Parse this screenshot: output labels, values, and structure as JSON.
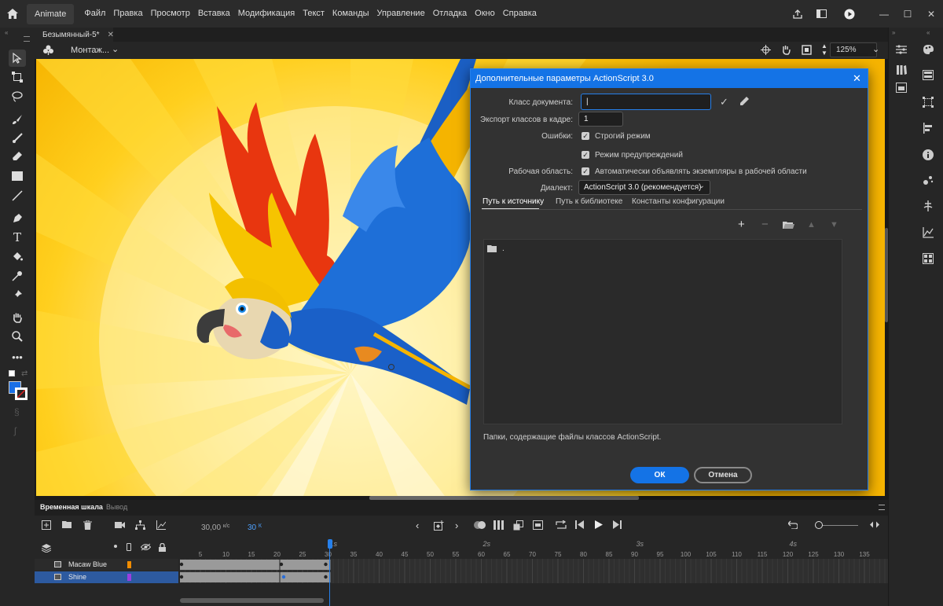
{
  "app": {
    "name": "Animate"
  },
  "menu": [
    "Файл",
    "Правка",
    "Просмотр",
    "Вставка",
    "Модификация",
    "Текст",
    "Команды",
    "Управление",
    "Отладка",
    "Окно",
    "Справка"
  ],
  "document": {
    "tab": "Безымянный-5*",
    "scene": "Монтаж..."
  },
  "editbar": {
    "zoom": "125%"
  },
  "dialog": {
    "title": "Дополнительные параметры ActionScript 3.0",
    "doc_class_label": "Класс документа:",
    "doc_class_value": "",
    "export_label": "Экспорт классов в кадре:",
    "export_value": "1",
    "errors_label": "Ошибки:",
    "strict_mode": "Строгий режим",
    "warnings_mode": "Режим предупреждений",
    "stage_label": "Рабочая область:",
    "auto_declare": "Автоматически объявлять экземпляры в рабочей области",
    "dialect_label": "Диалект:",
    "dialect_value": "ActionScript 3.0 (рекомендуется)",
    "tabs": [
      "Путь к источнику",
      "Путь к библиотеке",
      "Константы конфигурации"
    ],
    "path_entry": ".",
    "footnote": "Папки, содержащие файлы классов ActionScript.",
    "ok": "ОК",
    "cancel": "Отмена"
  },
  "timeline": {
    "tabs": [
      "Временная шкала",
      "Вывод"
    ],
    "fps": "30,00",
    "fps_unit": "к/с",
    "frame": "30",
    "frame_unit": "К",
    "seconds": [
      "1s",
      "2s",
      "3s",
      "4s"
    ],
    "frame_numbers": [
      "5",
      "10",
      "15",
      "20",
      "25",
      "30",
      "35",
      "40",
      "45",
      "50",
      "55",
      "60",
      "65",
      "70",
      "75",
      "80",
      "85",
      "90",
      "95",
      "100",
      "105",
      "110",
      "115",
      "120",
      "125",
      "130",
      "135"
    ],
    "layers": [
      {
        "name": "Macaw Blue",
        "color": "#f08c00"
      },
      {
        "name": "Shine",
        "color": "#9a3fe0"
      }
    ]
  },
  "colors": {
    "accent": "#1473e6",
    "stage_yellow": "#f4b400",
    "stroke": "#1a6fe6"
  }
}
